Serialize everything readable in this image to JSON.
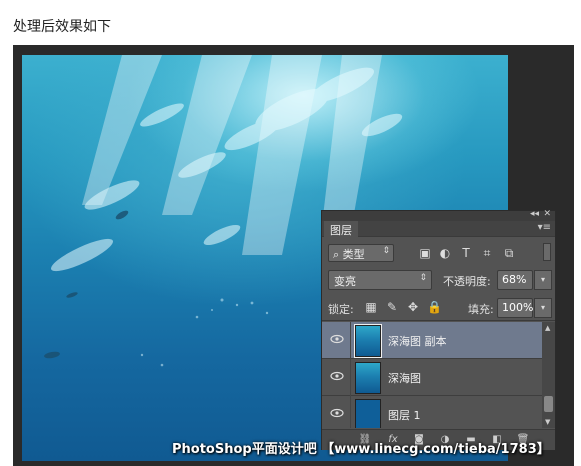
{
  "caption": "处理后效果如下",
  "layers_panel": {
    "tab_label": "图层",
    "filter_kind": "类型",
    "blend_mode": "变亮",
    "opacity_label": "不透明度:",
    "opacity_value": "68%",
    "lock_label": "锁定:",
    "fill_label": "填充:",
    "fill_value": "100%",
    "layers": [
      {
        "name": "深海图 副本",
        "selected": true
      },
      {
        "name": "深海图",
        "selected": false
      },
      {
        "name": "图层 1",
        "selected": false
      }
    ]
  },
  "watermark": "PhotoShop平面设计吧 【www.linecg.com/tieba/1783】",
  "icons": {
    "eye": "eye-icon",
    "search": "search-icon",
    "link": "link-icon",
    "fx": "fx-icon",
    "mask": "mask-icon",
    "adjustment": "adjustment-icon",
    "folder": "folder-icon",
    "new_layer": "new-layer-icon",
    "trash": "trash-icon"
  }
}
